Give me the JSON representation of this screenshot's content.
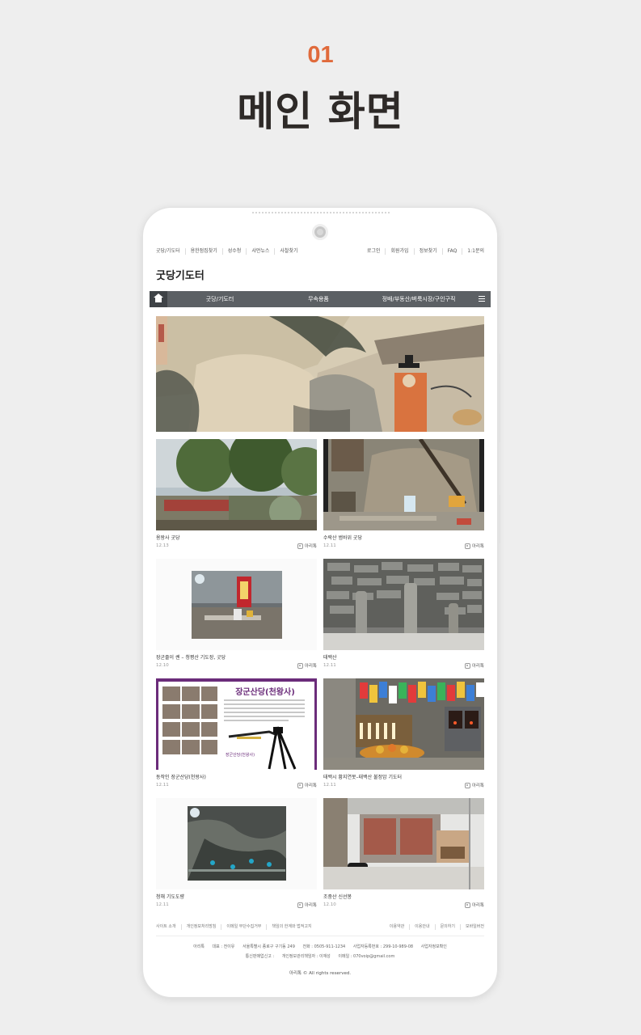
{
  "header": {
    "step": "01",
    "title": "메인 화면"
  },
  "util_nav": {
    "left": [
      "굿당/기도터",
      "용한점집찾기",
      "성수청",
      "샤먼뉴스",
      "사찰찾기"
    ],
    "right": [
      "로그인",
      "회원가입",
      "정보찾기",
      "FAQ",
      "1:1문의"
    ]
  },
  "site": {
    "title": "굿당기도터"
  },
  "main_nav": {
    "items": [
      "굿당/기도터",
      "무속용품",
      "정배/부동산/벼룩시장/구인구직"
    ]
  },
  "cards": [
    {
      "title": "용왕사 굿당",
      "date": "12.13",
      "author": "아리톡"
    },
    {
      "title": "수락산 범바위 굿당",
      "date": "12.11",
      "author": "아리톡"
    },
    {
      "title": "장군줄이 쎈 – 청평산 기도장, 굿당",
      "date": "12.10",
      "author": "아리톡"
    },
    {
      "title": "태백산",
      "date": "12.11",
      "author": "아리톡"
    },
    {
      "title": "동작인 장군산당(천왕사)",
      "date": "12.11",
      "author": "아리톡"
    },
    {
      "title": "태백시 황지연못–태백산 불정암 기도터",
      "date": "12.11",
      "author": "아리톡"
    },
    {
      "title": "청해 기도도량",
      "date": "12.11",
      "author": "아리톡"
    },
    {
      "title": "조중산 신선봉",
      "date": "12.10",
      "author": "아리톡"
    }
  ],
  "thumb_text": {
    "flyer_title": "장군산당(천왕사)",
    "flyer_caption": "장군산당(천왕사)"
  },
  "footer": {
    "links_left": [
      "사이트 소개",
      "개인정보처리방침",
      "이메일 무단수집거부",
      "책임의 한계와 법적고지"
    ],
    "links_right": [
      "이용약관",
      "이용안내",
      "문의하기",
      "모바일버전"
    ],
    "info_line1": [
      "아리톡",
      "대표 : 전이유",
      "서울특별시 종로구 구기동 249",
      "전화 : 0505-911-1234",
      "사업자등록번호 : 299-10-989-08",
      "사업자정보확인"
    ],
    "info_line2": [
      "통신판매업신고 :",
      "개인정보관리책임자 : 이재성",
      "이메일 : 070voip@gmail.com"
    ],
    "copyright": "아리톡 © All rights reserved."
  },
  "colors": {
    "accent": "#e06a3b",
    "nav_bg": "#5c6064",
    "page_bg": "#eeeeee"
  }
}
